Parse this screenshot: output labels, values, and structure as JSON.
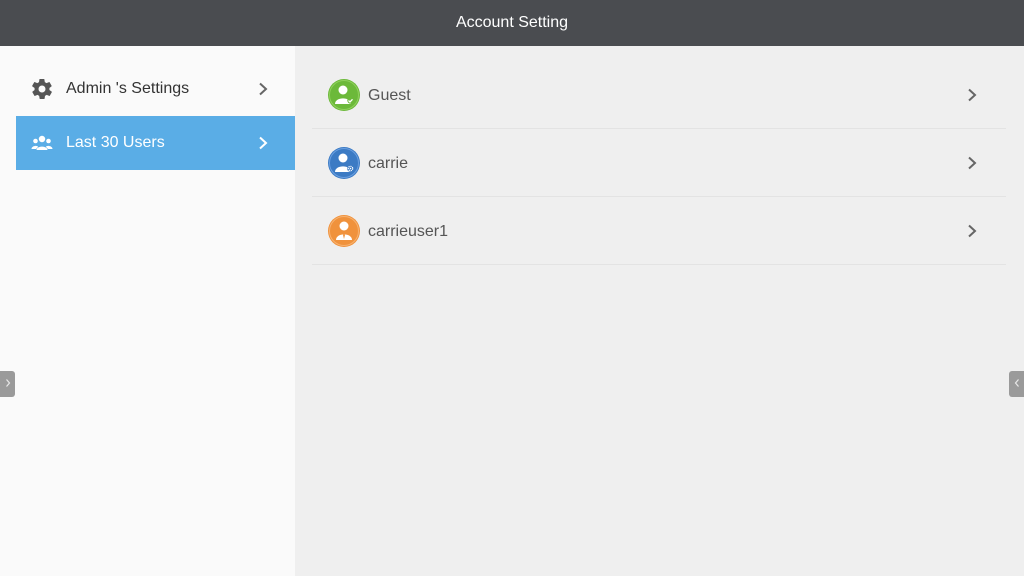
{
  "window": {
    "title": "Account Setting"
  },
  "sidebar": {
    "items": [
      {
        "label": "Admin 's Settings",
        "icon": "gear-icon",
        "selected": false
      },
      {
        "label": "Last 30 Users",
        "icon": "users-group-icon",
        "selected": true
      }
    ]
  },
  "users": [
    {
      "name": "Guest",
      "avatar": "guest-avatar-icon",
      "color": "#6cb93a"
    },
    {
      "name": "carrie",
      "avatar": "admin-avatar-icon",
      "color": "#3c7bc4"
    },
    {
      "name": "carrieuser1",
      "avatar": "user-avatar-icon",
      "color": "#f0923c"
    }
  ],
  "colors": {
    "titlebar": "#4a4c50",
    "selected": "#5aade6",
    "sidebar_bg": "#fafafa",
    "main_bg": "#efefef"
  }
}
